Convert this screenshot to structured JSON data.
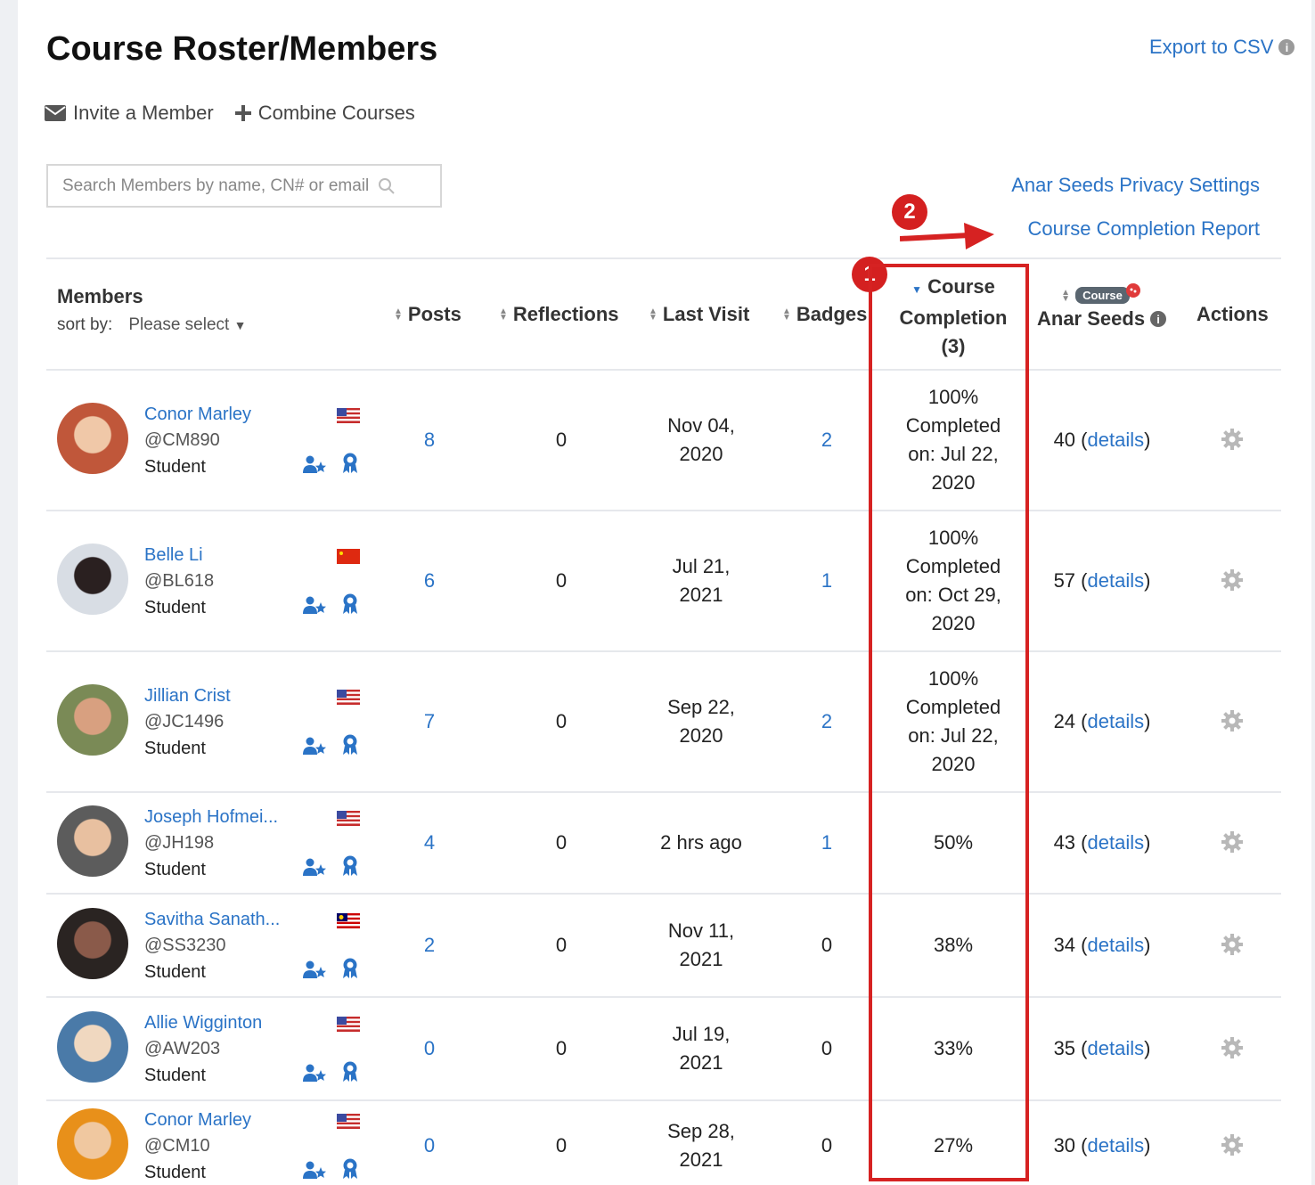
{
  "header": {
    "title": "Course Roster/Members",
    "export_label": "Export to CSV"
  },
  "toolbar": {
    "invite_label": "Invite a Member",
    "combine_label": "Combine Courses"
  },
  "search": {
    "placeholder": "Search Members by name, CN# or email"
  },
  "links": {
    "privacy": "Anar Seeds Privacy Settings",
    "completion_report": "Course Completion Report"
  },
  "annotations": {
    "one": "1",
    "two": "2",
    "color": "#d42020"
  },
  "table": {
    "members_header": "Members",
    "sort_by_label": "sort by:",
    "sort_select": "Please select",
    "col_posts": "Posts",
    "col_reflections": "Reflections",
    "col_last_visit": "Last Visit",
    "col_badges": "Badges",
    "col_completion_1": "Course",
    "col_completion_2": "Completion",
    "col_completion_3": "(3)",
    "col_seeds_pill": "Course",
    "col_seeds": "Anar Seeds",
    "col_actions": "Actions",
    "details_label": "details",
    "rows": [
      {
        "name": "Conor Marley",
        "handle": "@CM890",
        "role": "Student",
        "flag": "us",
        "posts": "8",
        "reflections": "0",
        "last_visit_1": "Nov 04,",
        "last_visit_2": "2020",
        "badges": "2",
        "completion": [
          "100%",
          "Completed",
          "on: Jul 22,",
          "2020"
        ],
        "seeds": "40"
      },
      {
        "name": "Belle Li",
        "handle": "@BL618",
        "role": "Student",
        "flag": "cn",
        "posts": "6",
        "reflections": "0",
        "last_visit_1": "Jul 21,",
        "last_visit_2": "2021",
        "badges": "1",
        "completion": [
          "100%",
          "Completed",
          "on: Oct 29,",
          "2020"
        ],
        "seeds": "57"
      },
      {
        "name": "Jillian Crist",
        "handle": "@JC1496",
        "role": "Student",
        "flag": "us",
        "posts": "7",
        "reflections": "0",
        "last_visit_1": "Sep 22,",
        "last_visit_2": "2020",
        "badges": "2",
        "completion": [
          "100%",
          "Completed",
          "on: Jul 22,",
          "2020"
        ],
        "seeds": "24"
      },
      {
        "name": "Joseph Hofmei...",
        "handle": "@JH198",
        "role": "Student",
        "flag": "us",
        "posts": "4",
        "reflections": "0",
        "last_visit_1": "2 hrs ago",
        "last_visit_2": "",
        "badges": "1",
        "completion": [
          "50%"
        ],
        "seeds": "43"
      },
      {
        "name": "Savitha Sanath...",
        "handle": "@SS3230",
        "role": "Student",
        "flag": "my",
        "posts": "2",
        "reflections": "0",
        "last_visit_1": "Nov 11,",
        "last_visit_2": "2021",
        "badges": "0",
        "completion": [
          "38%"
        ],
        "seeds": "34"
      },
      {
        "name": "Allie Wigginton",
        "handle": "@AW203",
        "role": "Student",
        "flag": "us",
        "posts": "0",
        "reflections": "0",
        "last_visit_1": "Jul 19,",
        "last_visit_2": "2021",
        "badges": "0",
        "completion": [
          "33%"
        ],
        "seeds": "35"
      },
      {
        "name": "Conor Marley",
        "handle": "@CM10",
        "role": "Student",
        "flag": "us",
        "posts": "0",
        "reflections": "0",
        "last_visit_1": "Sep 28,",
        "last_visit_2": "2021",
        "badges": "0",
        "completion": [
          "27%"
        ],
        "seeds": "30"
      }
    ]
  }
}
